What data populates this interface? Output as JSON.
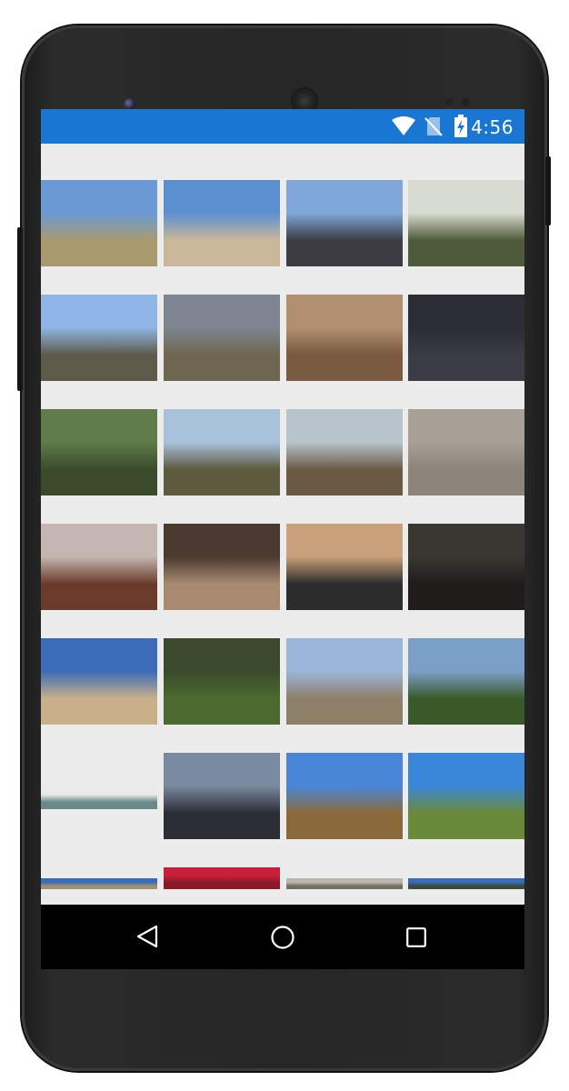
{
  "status_bar": {
    "time": "4:56",
    "icons": [
      "wifi-icon",
      "no-sim-icon",
      "battery-charging-icon"
    ],
    "color": "#1976d2"
  },
  "gallery": {
    "rows": [
      {
        "tiles": [
          {
            "name": "photo-desert-trail-sign",
            "sky": "#6a9ad6",
            "ground": "#a89a6e"
          },
          {
            "name": "photo-boulders-blue-sky",
            "sky": "#5b8fd0",
            "ground": "#cbb79a"
          },
          {
            "name": "photo-road-to-snowy-peak",
            "sky": "#7fa8d8",
            "ground": "#3c3c42"
          },
          {
            "name": "photo-canyon-creek",
            "sky": "#d8dbd0",
            "ground": "#4f5a3a"
          }
        ]
      },
      {
        "tiles": [
          {
            "name": "photo-white-village-street",
            "sky": "#8fb6e6",
            "ground": "#5e5a4a"
          },
          {
            "name": "photo-lake-cloudy-hills",
            "sky": "#7d8690",
            "ground": "#6e6650"
          },
          {
            "name": "photo-stone-carving-head",
            "sky": "#b09070",
            "ground": "#7a5a40"
          },
          {
            "name": "photo-pixel-invaders-wall",
            "sky": "#2c2c34",
            "ground": "#3b3b44"
          }
        ]
      },
      {
        "tiles": [
          {
            "name": "photo-ruins-in-jungle",
            "sky": "#5f7c4a",
            "ground": "#3a4a2a"
          },
          {
            "name": "photo-rocky-mountains",
            "sky": "#a9c2dc",
            "ground": "#5d5a3e"
          },
          {
            "name": "photo-valley-overlook",
            "sky": "#b8c4cc",
            "ground": "#6a5a44"
          },
          {
            "name": "photo-carved-stone-relief",
            "sky": "#a7a096",
            "ground": "#8b847a"
          }
        ]
      },
      {
        "tiles": [
          {
            "name": "photo-coast-sunset-cliff",
            "sky": "#c4b6b0",
            "ground": "#6a3a2a"
          },
          {
            "name": "photo-building-ceiling",
            "sky": "#4a3a30",
            "ground": "#a88a70"
          },
          {
            "name": "photo-bay-sunset",
            "sky": "#c9a07a",
            "ground": "#2c2c2c"
          },
          {
            "name": "photo-dark-interior",
            "sky": "#3a3632",
            "ground": "#1f1c1a"
          }
        ]
      },
      {
        "tiles": [
          {
            "name": "photo-sandstone-sky",
            "sky": "#3a6cb8",
            "ground": "#c9b08a"
          },
          {
            "name": "photo-pink-flowers",
            "sky": "#3b4a2c",
            "ground": "#4a6a30"
          },
          {
            "name": "photo-city-skyline-day",
            "sky": "#9ab6d8",
            "ground": "#8e8068"
          },
          {
            "name": "photo-flower-rock",
            "sky": "#7aa0c8",
            "ground": "#3a5a2a"
          }
        ]
      },
      {
        "tiles": [
          {
            "name": "photo-river-panorama",
            "sky": "#eaeaea",
            "ground": "#6a8a8a",
            "panorama": true
          },
          {
            "name": "photo-city-skyline-dusk",
            "sky": "#7a8aa0",
            "ground": "#2c2e36"
          },
          {
            "name": "photo-metal-dinosaur",
            "sky": "#4a86d8",
            "ground": "#8a6a3a"
          },
          {
            "name": "photo-festival-tents",
            "sky": "#3a86d8",
            "ground": "#6a8a3a"
          }
        ]
      },
      {
        "tiles": [
          {
            "name": "photo-partial-1",
            "sky": "#3a6cb8",
            "ground": "#a09070"
          },
          {
            "name": "photo-partial-2",
            "sky": "#c8203a",
            "ground": "#8a1a2a"
          },
          {
            "name": "photo-partial-3",
            "sky": "#b8b8b0",
            "ground": "#707060"
          },
          {
            "name": "photo-partial-4",
            "sky": "#3a6cb8",
            "ground": "#3a4a3a"
          }
        ]
      }
    ]
  },
  "nav_bar": {
    "icons": [
      "back-icon",
      "home-icon",
      "recent-apps-icon"
    ]
  }
}
